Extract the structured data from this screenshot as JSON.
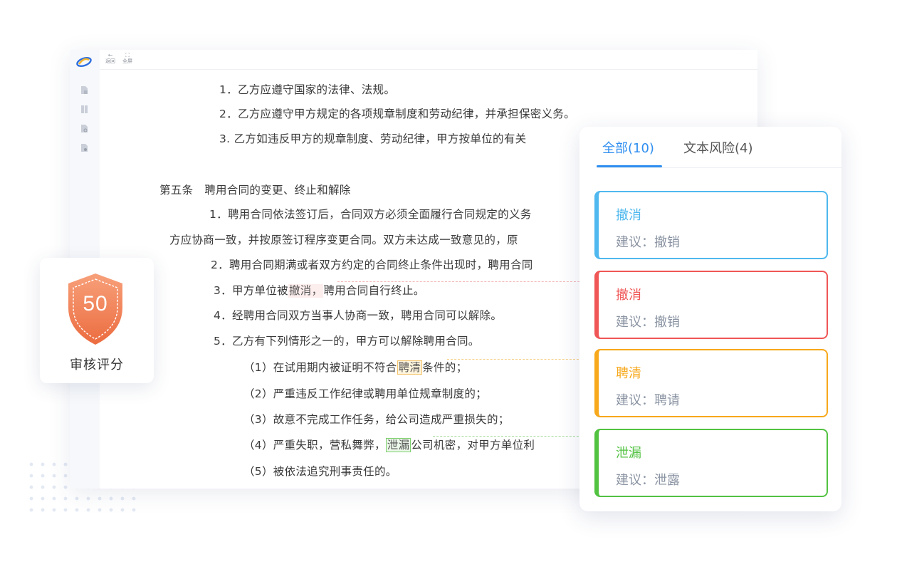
{
  "toolbar": {
    "back_label": "返回",
    "fullscreen_label": "全屏"
  },
  "document": {
    "lines": [
      "1．乙方应遵守国家的法律、法规。",
      "2．乙方应遵守甲方规定的各项规章制度和劳动纪律，并承担保密义务。",
      "3. 乙方如违反甲方的规章制度、劳动纪律，甲方按单位的有关",
      "第五条　聘用合同的变更、终止和解除",
      "1．聘用合同依法签订后，合同双方必须全面履行合同规定的义务",
      "方应协商一致，并按原签订程序变更合同。双方未达成一致意见的，原",
      "2．聘用合同期满或者双方约定的合同终止条件出现时，聘用合同",
      "4．经聘用合同双方当事人协商一致，聘用合同可以解除。",
      "5．乙方有下列情形之一的，甲方可以解除聘用合同。",
      "（2）严重违反工作纪律或聘用单位规章制度的；",
      "（3）故意不完成工作任务，给公司造成严重损失的；",
      "（5）被依法追究刑事责任的。"
    ],
    "line3": {
      "before": "3．甲方单位被",
      "flag": "撤消，",
      "after": "聘用合同自行终止。"
    },
    "line_1_trial": {
      "before": "（1）在试用期内被证明不符合",
      "flag": "聘清",
      "after": "条件的；"
    },
    "line_4_leak": {
      "before": "（4）严重失职，营私舞弊，",
      "flag": "泄漏",
      "after": "公司机密，对甲方单位利"
    }
  },
  "score": {
    "value": "50",
    "label": "审核评分"
  },
  "risk_panel": {
    "tabs": [
      {
        "label": "全部(10)",
        "active": true
      },
      {
        "label": "文本风险(4)",
        "active": false
      }
    ],
    "items": [
      {
        "title": "撤消",
        "suggestion": "建议：撤销",
        "color": "#4fb8ee"
      },
      {
        "title": "撤消",
        "suggestion": "建议：撤销",
        "color": "#f05656"
      },
      {
        "title": "聘清",
        "suggestion": "建议：聘请",
        "color": "#f7a81b"
      },
      {
        "title": "泄漏",
        "suggestion": "建议：泄露",
        "color": "#52c241"
      }
    ]
  },
  "colors": {
    "accent": "#2f8ef0",
    "shield": "#f07e55"
  }
}
